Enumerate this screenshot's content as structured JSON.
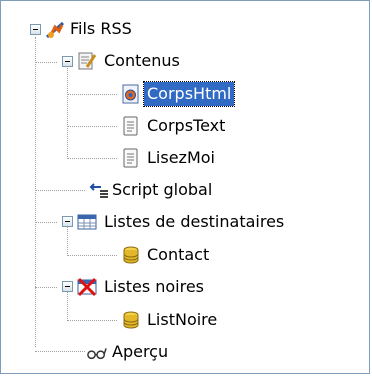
{
  "tree": {
    "root": {
      "label": "Fils RSS",
      "icon": "rss-feeds-icon",
      "expanded": true
    },
    "contenus": {
      "label": "Contenus",
      "icon": "document-edit-icon",
      "expanded": true
    },
    "corpshtml": {
      "label": "CorpsHtml",
      "icon": "html-page-icon",
      "selected": true
    },
    "corpstext": {
      "label": "CorpsText",
      "icon": "text-file-icon"
    },
    "lisezmoi": {
      "label": "LisezMoi",
      "icon": "text-file-icon"
    },
    "script": {
      "label": "Script global",
      "icon": "script-icon"
    },
    "destinataires": {
      "label": "Listes de destinataires",
      "icon": "table-icon",
      "expanded": true
    },
    "contact": {
      "label": "Contact",
      "icon": "database-icon"
    },
    "noires": {
      "label": "Listes noires",
      "icon": "blacklist-icon",
      "expanded": true
    },
    "listnoire": {
      "label": "ListNoire",
      "icon": "database-icon"
    },
    "apercu": {
      "label": "Aperçu",
      "icon": "glasses-icon"
    }
  },
  "colors": {
    "selection": "#316ac5",
    "border": "#7f9db9",
    "tree_lines": "#a0a0a0"
  }
}
